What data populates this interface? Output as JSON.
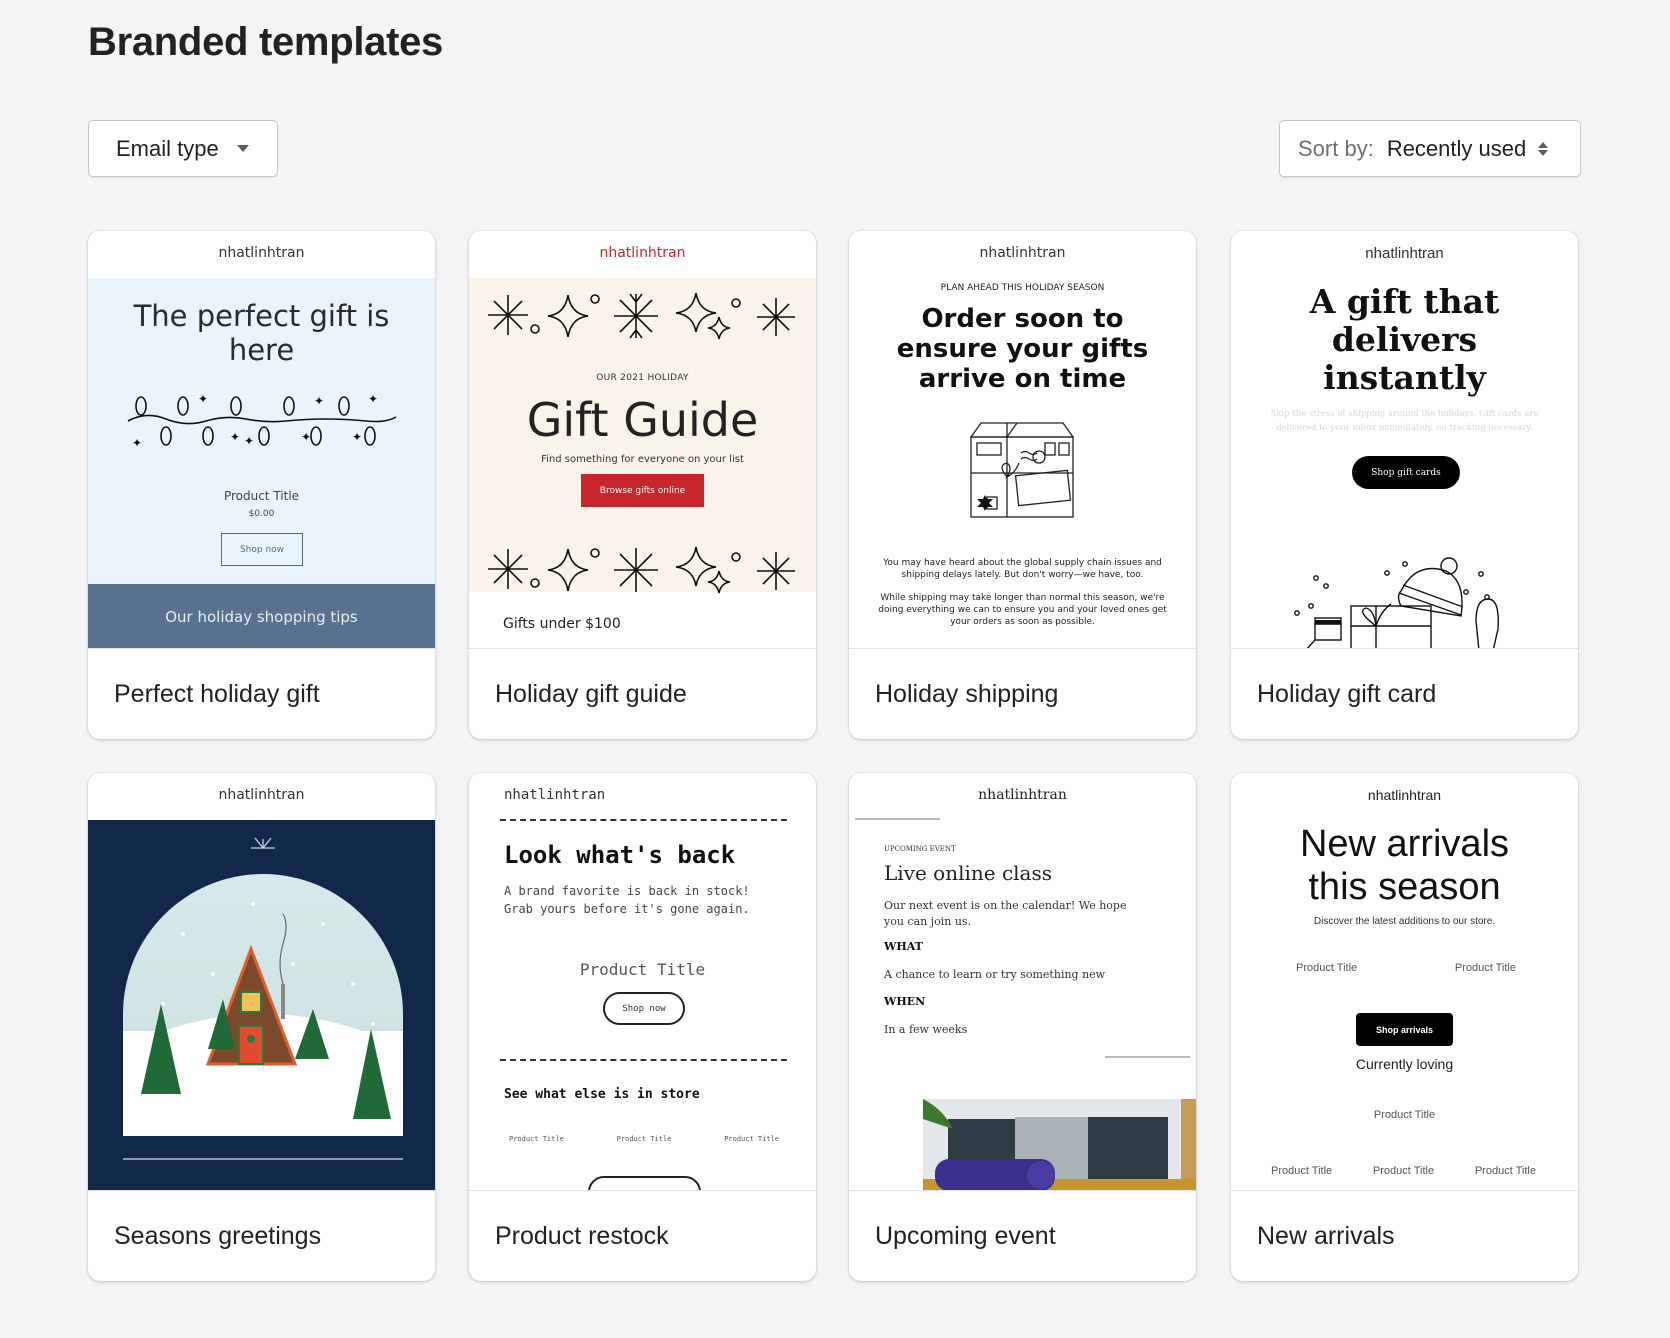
{
  "page": {
    "title": "Branded templates"
  },
  "filters": {
    "email_type_label": "Email type",
    "sort_label": "Sort by:",
    "sort_value": "Recently used"
  },
  "brand_name": "nhatlinhtran",
  "colors": {
    "background": "#f4f4f6",
    "gift_guide_accent": "#c8252c",
    "holiday_tips_band": "#57718f",
    "seasons_navy": "#12284a"
  },
  "templates": [
    {
      "name": "Perfect holiday gift",
      "preview": {
        "brand": "nhatlinhtran",
        "headline": "The perfect gift is here",
        "image": "string-lights-illustration",
        "product_title": "Product Title",
        "price": "$0.00",
        "button": "Shop now",
        "banner": "Our holiday shopping tips"
      }
    },
    {
      "name": "Holiday gift guide",
      "preview": {
        "brand": "nhatlinhtran",
        "eyebrow": "OUR 2021 HOLIDAY",
        "headline": "Gift Guide",
        "subtext": "Find something for everyone on your list",
        "button": "Browse gifts online",
        "section": "Gifts under $100"
      }
    },
    {
      "name": "Holiday shipping",
      "preview": {
        "brand": "nhatlinhtran",
        "eyebrow": "PLAN AHEAD THIS HOLIDAY SEASON",
        "headline": "Order soon to ensure your gifts arrive on time",
        "image": "parcel-box-illustration",
        "body_1": "You may have heard about the global supply chain issues and shipping delays lately. But don't worry—we have, too.",
        "body_2": "While shipping may take longer than normal this season, we're doing everything we can to ensure you and your loved ones get your orders as soon as possible."
      }
    },
    {
      "name": "Holiday gift card",
      "preview": {
        "brand": "nhatlinhtran",
        "headline": "A gift that delivers instantly",
        "subtext": "Skip the stress of shipping around the holidays. Gift cards are delivered to your inbox immediately, no tracking necessary.",
        "button": "Shop gift cards",
        "image": "winter-gifts-illustration"
      }
    },
    {
      "name": "Seasons greetings",
      "preview": {
        "brand": "nhatlinhtran",
        "image": "snow-globe-cabin-illustration"
      }
    },
    {
      "name": "Product restock",
      "preview": {
        "brand": "nhatlinhtran",
        "headline": "Look what's back",
        "subtext_1": "A brand favorite is back in stock!",
        "subtext_2": "Grab yours before it's gone again.",
        "product_title": "Product Title",
        "button": "Shop now",
        "section": "See what else is in store",
        "products": [
          "Product Title",
          "Product Title",
          "Product Title"
        ]
      }
    },
    {
      "name": "Upcoming event",
      "preview": {
        "brand": "nhatlinhtran",
        "eyebrow": "UPCOMING EVENT",
        "headline": "Live online class",
        "body": "Our next event is on the calendar! We hope you can join us.",
        "what_label": "WHAT",
        "what_value": "A chance to learn or try something new",
        "when_label": "WHEN",
        "when_value": "In a few weeks",
        "image": "yoga-mat-cushions-photo"
      }
    },
    {
      "name": "New arrivals",
      "preview": {
        "brand": "nhatlinhtran",
        "headline": "New arrivals this season",
        "subtext": "Discover the latest additions to our store.",
        "products_row_1": [
          "Product Title",
          "Product Title"
        ],
        "button": "Shop arrivals",
        "section": "Currently loving",
        "product_single": "Product Title",
        "products_row_3": [
          "Product Title",
          "Product Title",
          "Product Title"
        ]
      }
    }
  ]
}
